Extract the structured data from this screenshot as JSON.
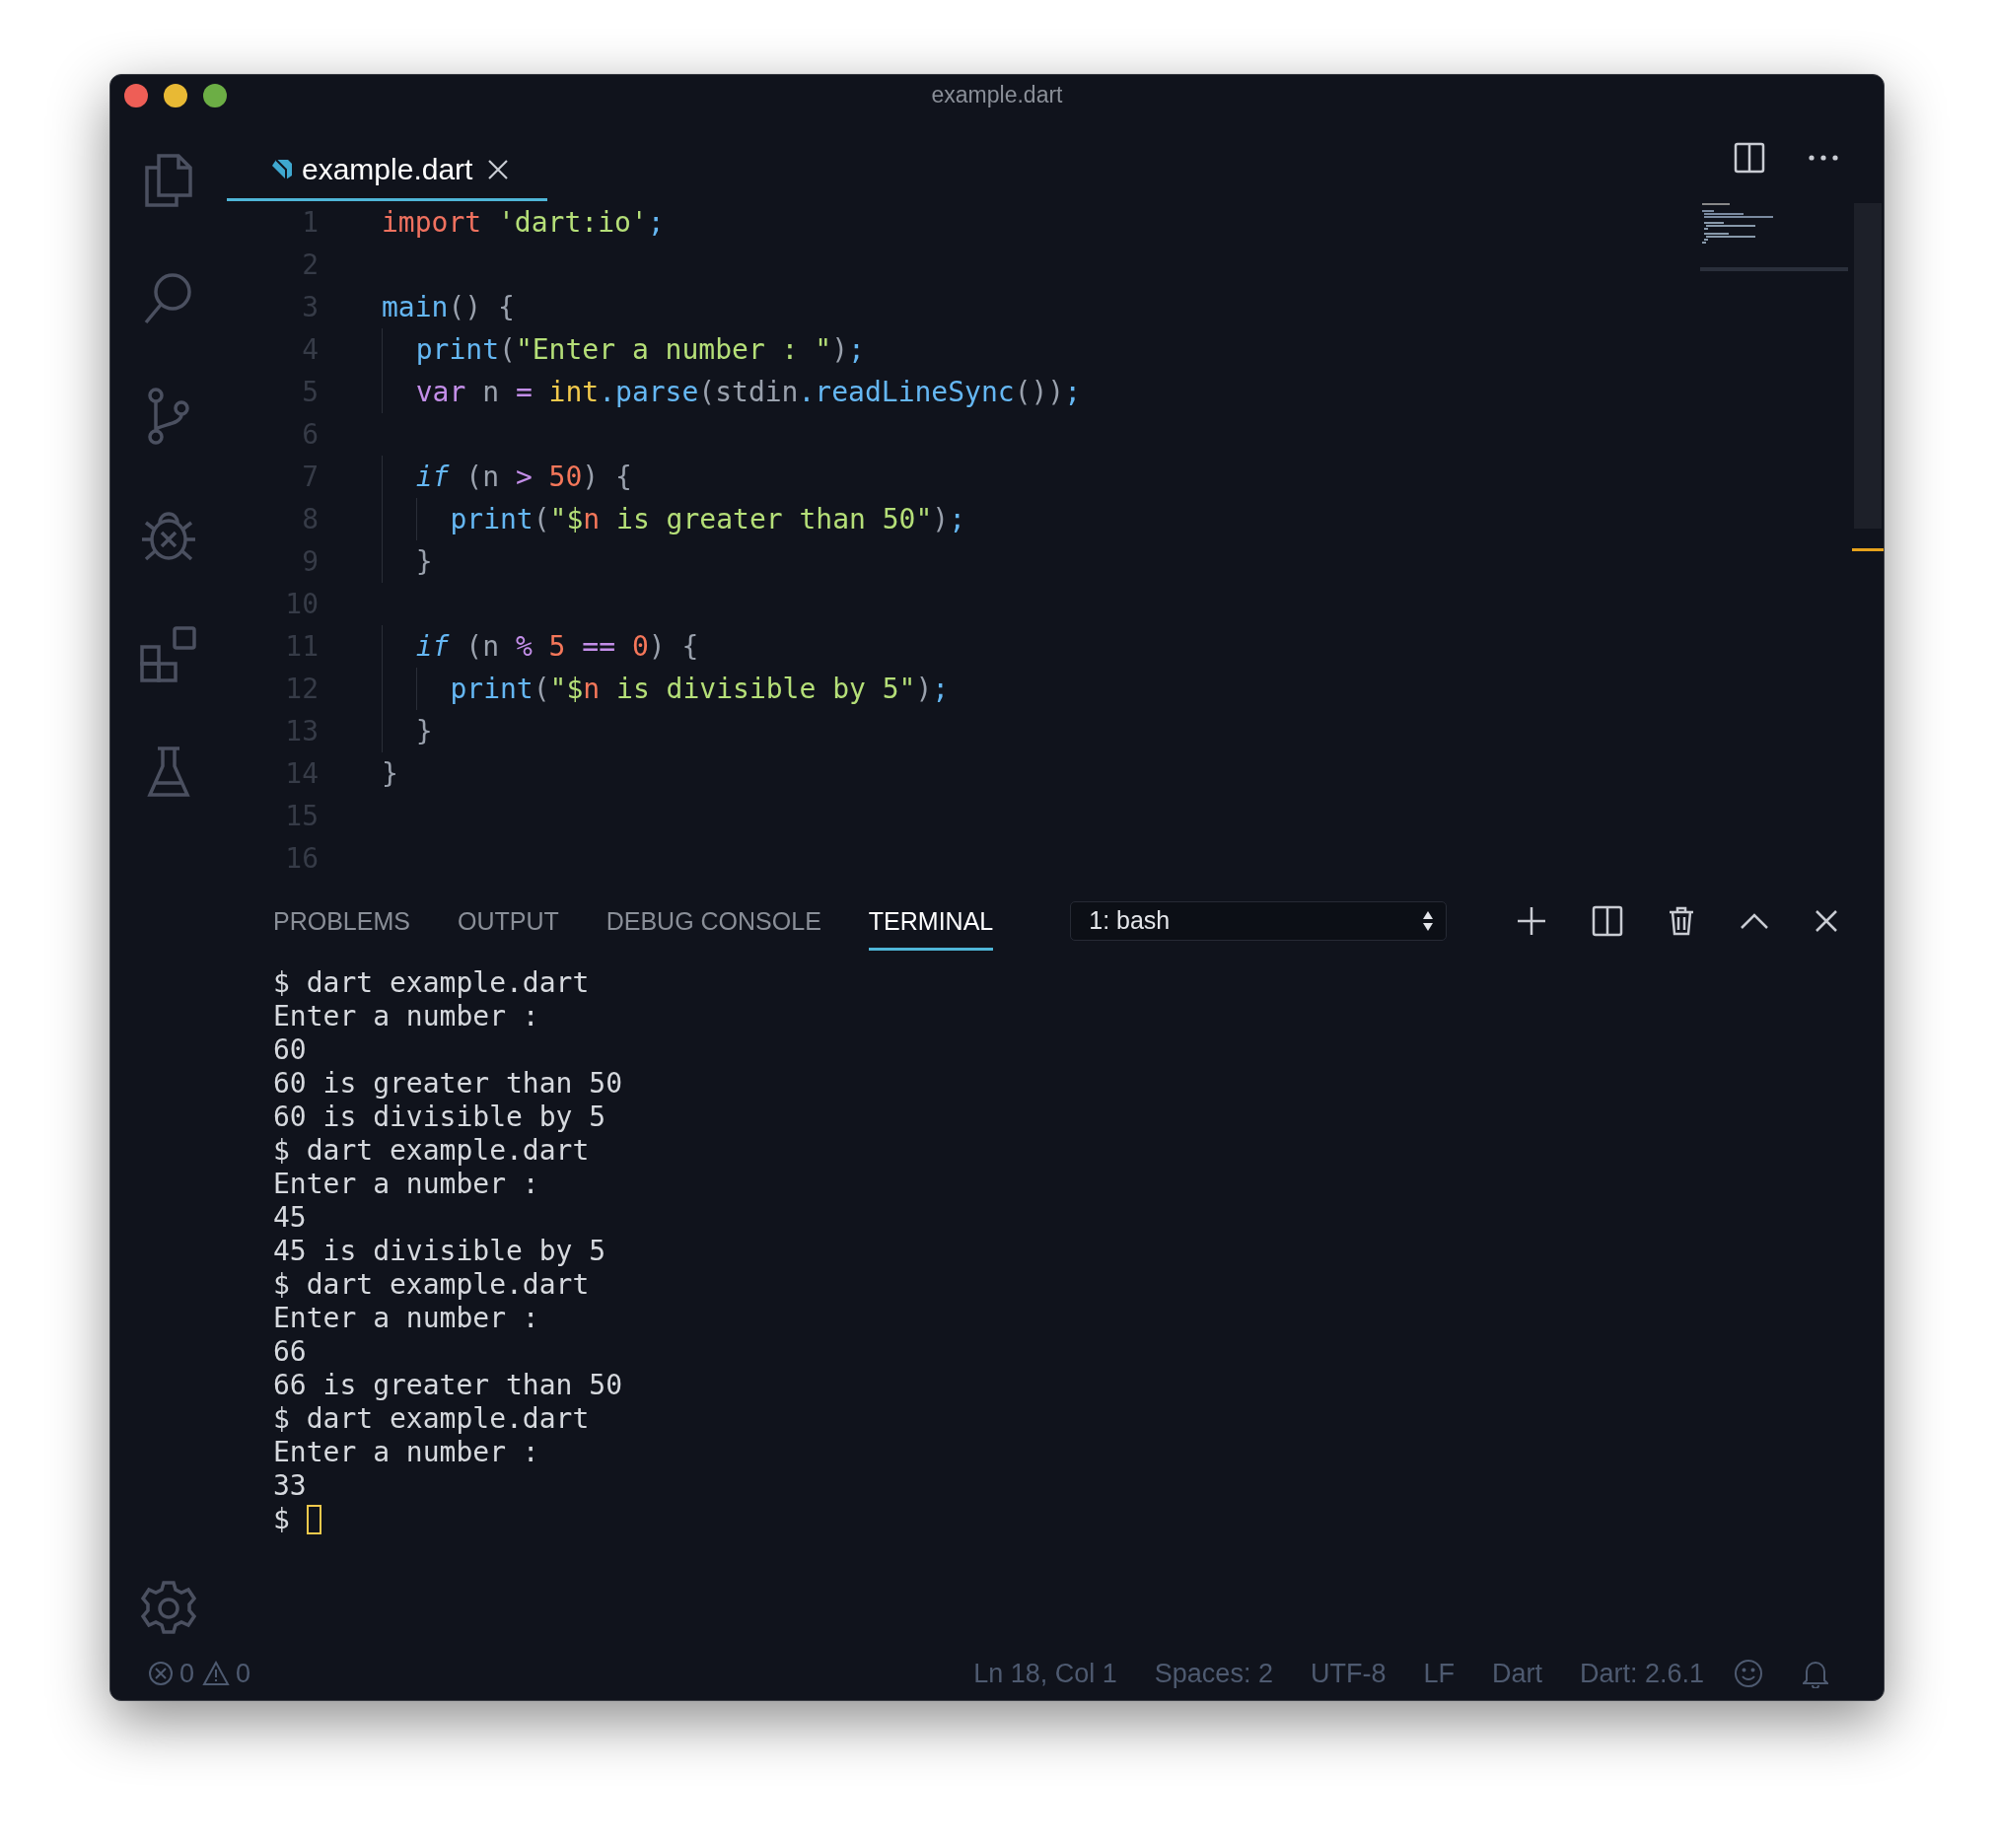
{
  "window": {
    "title": "example.dart"
  },
  "editor_tabs": [
    {
      "label": "example.dart",
      "selected": true
    }
  ],
  "code_lines": [
    {
      "number": "1",
      "tokens": [
        {
          "text": "import",
          "kind": "keyword"
        },
        {
          "text": " 'dart:io'",
          "kind": "string"
        },
        {
          "text": ";",
          "kind": "accessor"
        }
      ]
    },
    {
      "number": "2"
    },
    {
      "number": "3",
      "tokens": [
        {
          "text": "main",
          "kind": "func"
        },
        {
          "text": "() {",
          "kind": "punct"
        }
      ]
    },
    {
      "number": "4",
      "tokens": [
        {
          "text": "  print",
          "kind": "func"
        },
        {
          "text": "(",
          "kind": "punct"
        },
        {
          "text": "\"Enter a number : \"",
          "kind": "string"
        },
        {
          "text": ")",
          "kind": "punct"
        },
        {
          "text": ";",
          "kind": "accessor"
        }
      ]
    },
    {
      "number": "5",
      "tokens": [
        {
          "text": "  var",
          "kind": "storage"
        },
        {
          "text": " n ",
          "kind": "plain"
        },
        {
          "text": "=",
          "kind": "operator"
        },
        {
          "text": " int",
          "kind": "type"
        },
        {
          "text": ".",
          "kind": "accessor"
        },
        {
          "text": "parse",
          "kind": "func"
        },
        {
          "text": "(stdin",
          "kind": "punct"
        },
        {
          "text": ".",
          "kind": "accessor"
        },
        {
          "text": "readLineSync",
          "kind": "func"
        },
        {
          "text": "())",
          "kind": "punct"
        },
        {
          "text": ";",
          "kind": "accessor"
        }
      ]
    },
    {
      "number": "6"
    },
    {
      "number": "7",
      "tokens": [
        {
          "text": "  if",
          "kind": "control"
        },
        {
          "text": " (n ",
          "kind": "punct"
        },
        {
          "text": ">",
          "kind": "operator"
        },
        {
          "text": " 50",
          "kind": "number"
        },
        {
          "text": ") {",
          "kind": "punct"
        }
      ]
    },
    {
      "number": "8",
      "tokens": [
        {
          "text": "    print",
          "kind": "func"
        },
        {
          "text": "(",
          "kind": "punct"
        },
        {
          "text": "\"$",
          "kind": "string"
        },
        {
          "text": "n",
          "kind": "variable"
        },
        {
          "text": " is greater than 50\"",
          "kind": "string"
        },
        {
          "text": ")",
          "kind": "punct"
        },
        {
          "text": ";",
          "kind": "accessor"
        }
      ]
    },
    {
      "number": "9",
      "tokens": [
        {
          "text": "  }",
          "kind": "punct"
        }
      ]
    },
    {
      "number": "10"
    },
    {
      "number": "11",
      "tokens": [
        {
          "text": "  if",
          "kind": "control"
        },
        {
          "text": " (n ",
          "kind": "punct"
        },
        {
          "text": "%",
          "kind": "operator"
        },
        {
          "text": " 5",
          "kind": "number"
        },
        {
          "text": " ==",
          "kind": "operator"
        },
        {
          "text": " 0",
          "kind": "number"
        },
        {
          "text": ") {",
          "kind": "punct"
        }
      ]
    },
    {
      "number": "12",
      "tokens": [
        {
          "text": "    print",
          "kind": "func"
        },
        {
          "text": "(",
          "kind": "punct"
        },
        {
          "text": "\"$",
          "kind": "string"
        },
        {
          "text": "n",
          "kind": "variable"
        },
        {
          "text": " is divisible by 5\"",
          "kind": "string"
        },
        {
          "text": ")",
          "kind": "punct"
        },
        {
          "text": ";",
          "kind": "accessor"
        }
      ]
    },
    {
      "number": "13",
      "tokens": [
        {
          "text": "  }",
          "kind": "punct"
        }
      ]
    },
    {
      "number": "14",
      "tokens": [
        {
          "text": "}",
          "kind": "punct"
        }
      ]
    },
    {
      "number": "15"
    },
    {
      "number": "16"
    }
  ],
  "panel_tabs": [
    {
      "label": "PROBLEMS",
      "selected": false
    },
    {
      "label": "OUTPUT",
      "selected": false
    },
    {
      "label": "DEBUG CONSOLE",
      "selected": false
    },
    {
      "label": "TERMINAL",
      "selected": true
    }
  ],
  "terminal_selector": {
    "value": "1: bash"
  },
  "terminal": {
    "lines": [
      "$ dart example.dart",
      "Enter a number :",
      "60",
      "60 is greater than 50",
      "60 is divisible by 5",
      "$ dart example.dart",
      "Enter a number :",
      "45",
      "45 is divisible by 5",
      "$ dart example.dart",
      "Enter a number :",
      "66",
      "66 is greater than 50",
      "$ dart example.dart",
      "Enter a number :",
      "33"
    ],
    "prompt": "$",
    "cursor": true
  },
  "status_bar": {
    "errors": "0",
    "warnings": "0",
    "items": [
      "Ln 18, Col 1",
      "Spaces: 2",
      "UTF-8",
      "LF",
      "Dart",
      "Dart: 2.6.1"
    ]
  }
}
